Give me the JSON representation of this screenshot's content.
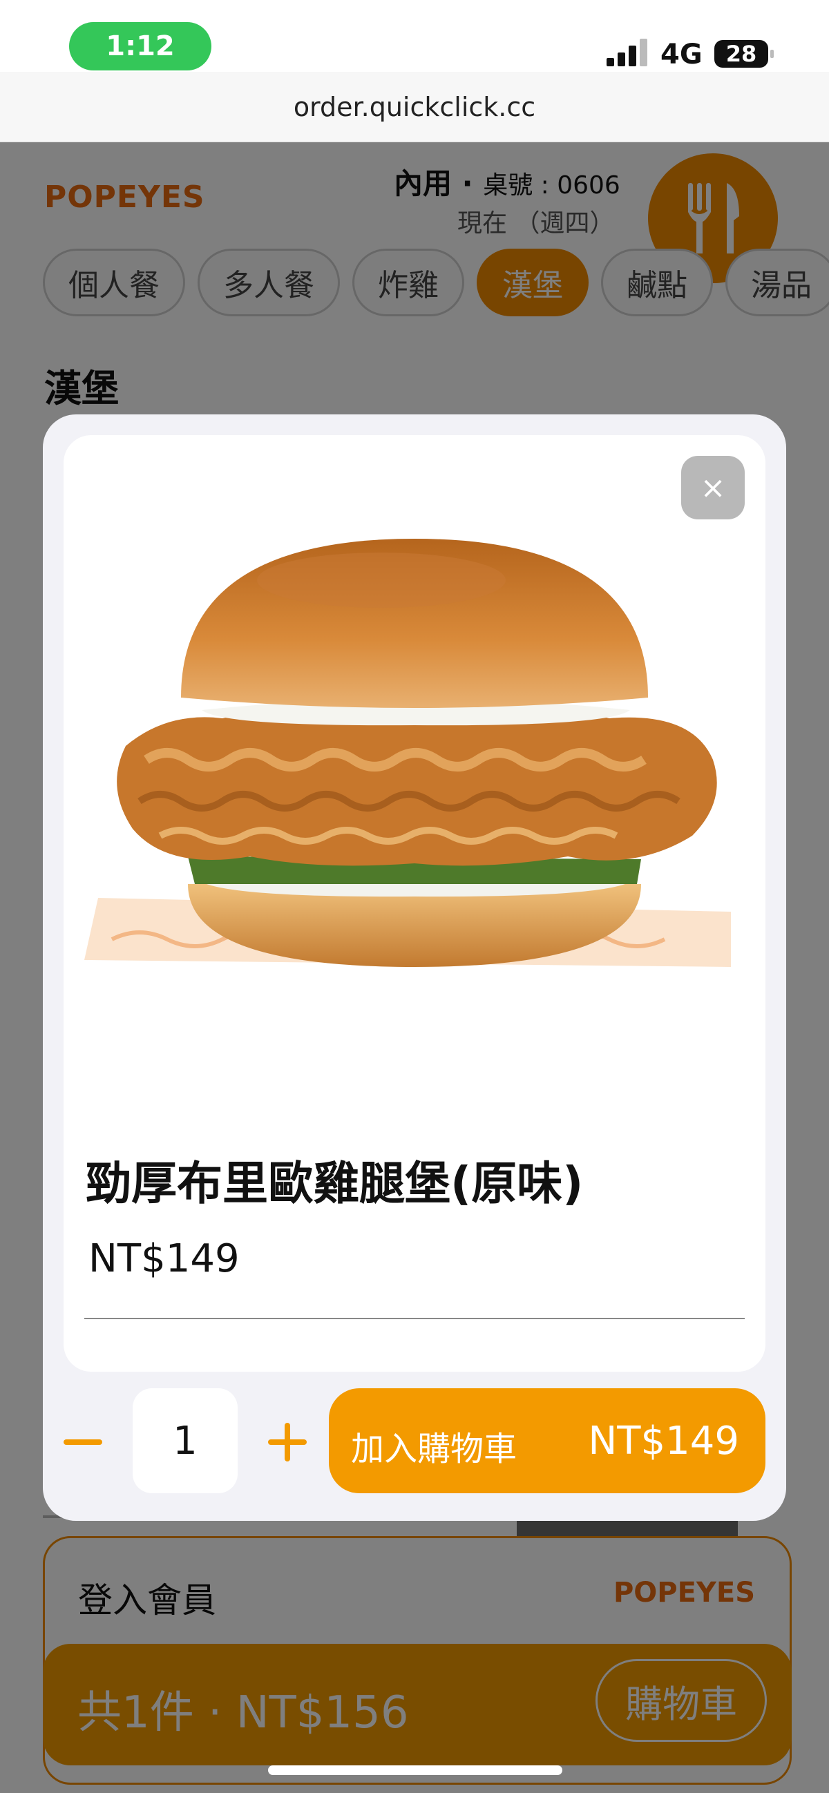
{
  "status_bar": {
    "time": "1:12",
    "network": "4G",
    "battery": "28"
  },
  "browser": {
    "url": "order.quickclick.cc"
  },
  "header": {
    "logo": "POPEYES",
    "dine_mode": "內用 · ",
    "table_label": "桌號 : 0606",
    "time_label": "現在 （週四）"
  },
  "tabs": [
    {
      "label": "個人餐"
    },
    {
      "label": "多人餐"
    },
    {
      "label": "炸雞"
    },
    {
      "label": "漢堡",
      "active": true
    },
    {
      "label": "鹹點"
    },
    {
      "label": "湯品"
    }
  ],
  "section_title": "漢堡",
  "modal": {
    "close_icon": "×",
    "product_name": "勁厚布里歐雞腿堡(原味)",
    "price": "NT$149",
    "quantity": "1",
    "add_to_cart_label": "加入購物車",
    "add_to_cart_price": "NT$149"
  },
  "member": {
    "label": "登入會員",
    "logo": "POPEYES"
  },
  "cart": {
    "summary": "共1件 · NT$156",
    "button": "購物車"
  },
  "colors": {
    "accent": "#f39a00",
    "brand": "#e86a10"
  }
}
